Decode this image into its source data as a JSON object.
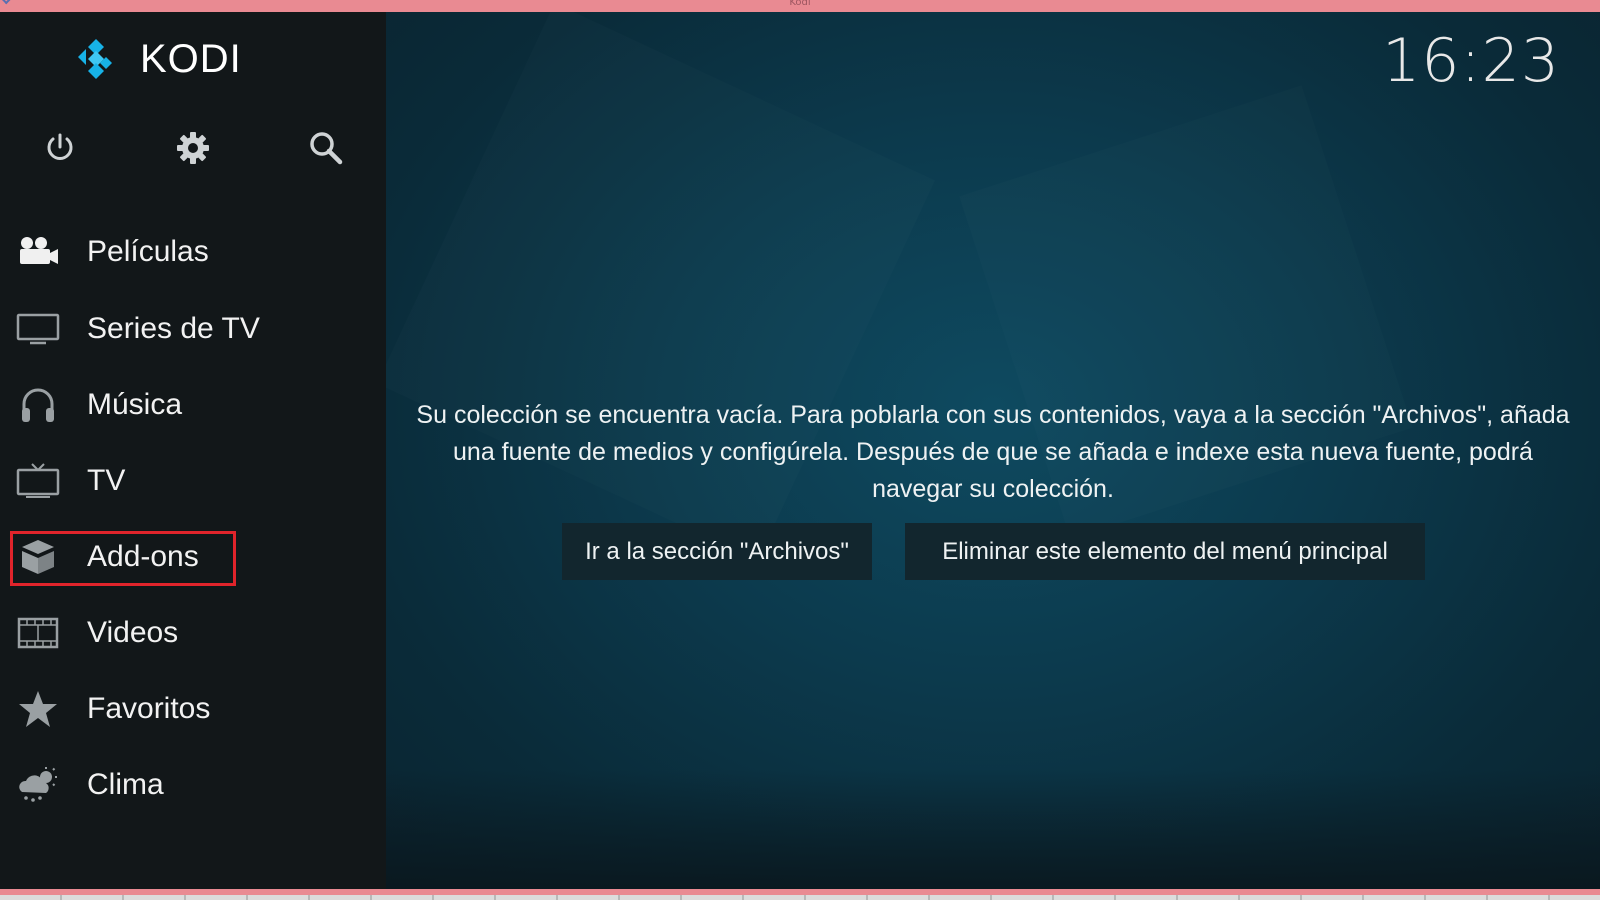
{
  "window": {
    "title": "Kodi"
  },
  "app": {
    "logo_text": "KODI",
    "clock": "16:23"
  },
  "quick_actions": [
    {
      "name": "power",
      "icon": "power-icon"
    },
    {
      "name": "settings",
      "icon": "gear-icon"
    },
    {
      "name": "search",
      "icon": "search-icon"
    }
  ],
  "menu": {
    "items": [
      {
        "label": "Películas",
        "icon": "movie-camera-icon"
      },
      {
        "label": "Series de TV",
        "icon": "monitor-icon"
      },
      {
        "label": "Música",
        "icon": "headphones-icon"
      },
      {
        "label": "TV",
        "icon": "tv-icon"
      },
      {
        "label": "Add-ons",
        "icon": "box-icon"
      },
      {
        "label": "Videos",
        "icon": "film-strip-icon"
      },
      {
        "label": "Favoritos",
        "icon": "star-icon"
      },
      {
        "label": "Clima",
        "icon": "weather-icon"
      }
    ]
  },
  "main": {
    "message": "Su colección se encuentra vacía. Para poblarla con sus contenidos, vaya a la sección \"Archivos\", añada una fuente de medios y configúrela. Después de que se añada e indexe esta nueva fuente, podrá navegar su colección.",
    "button_files": "Ir a la sección \"Archivos\"",
    "button_remove": "Eliminar este elemento del menú principal"
  },
  "colors": {
    "accent": "#17b2e7",
    "sidebar_bg": "#121719",
    "highlight": "#e0242b"
  }
}
